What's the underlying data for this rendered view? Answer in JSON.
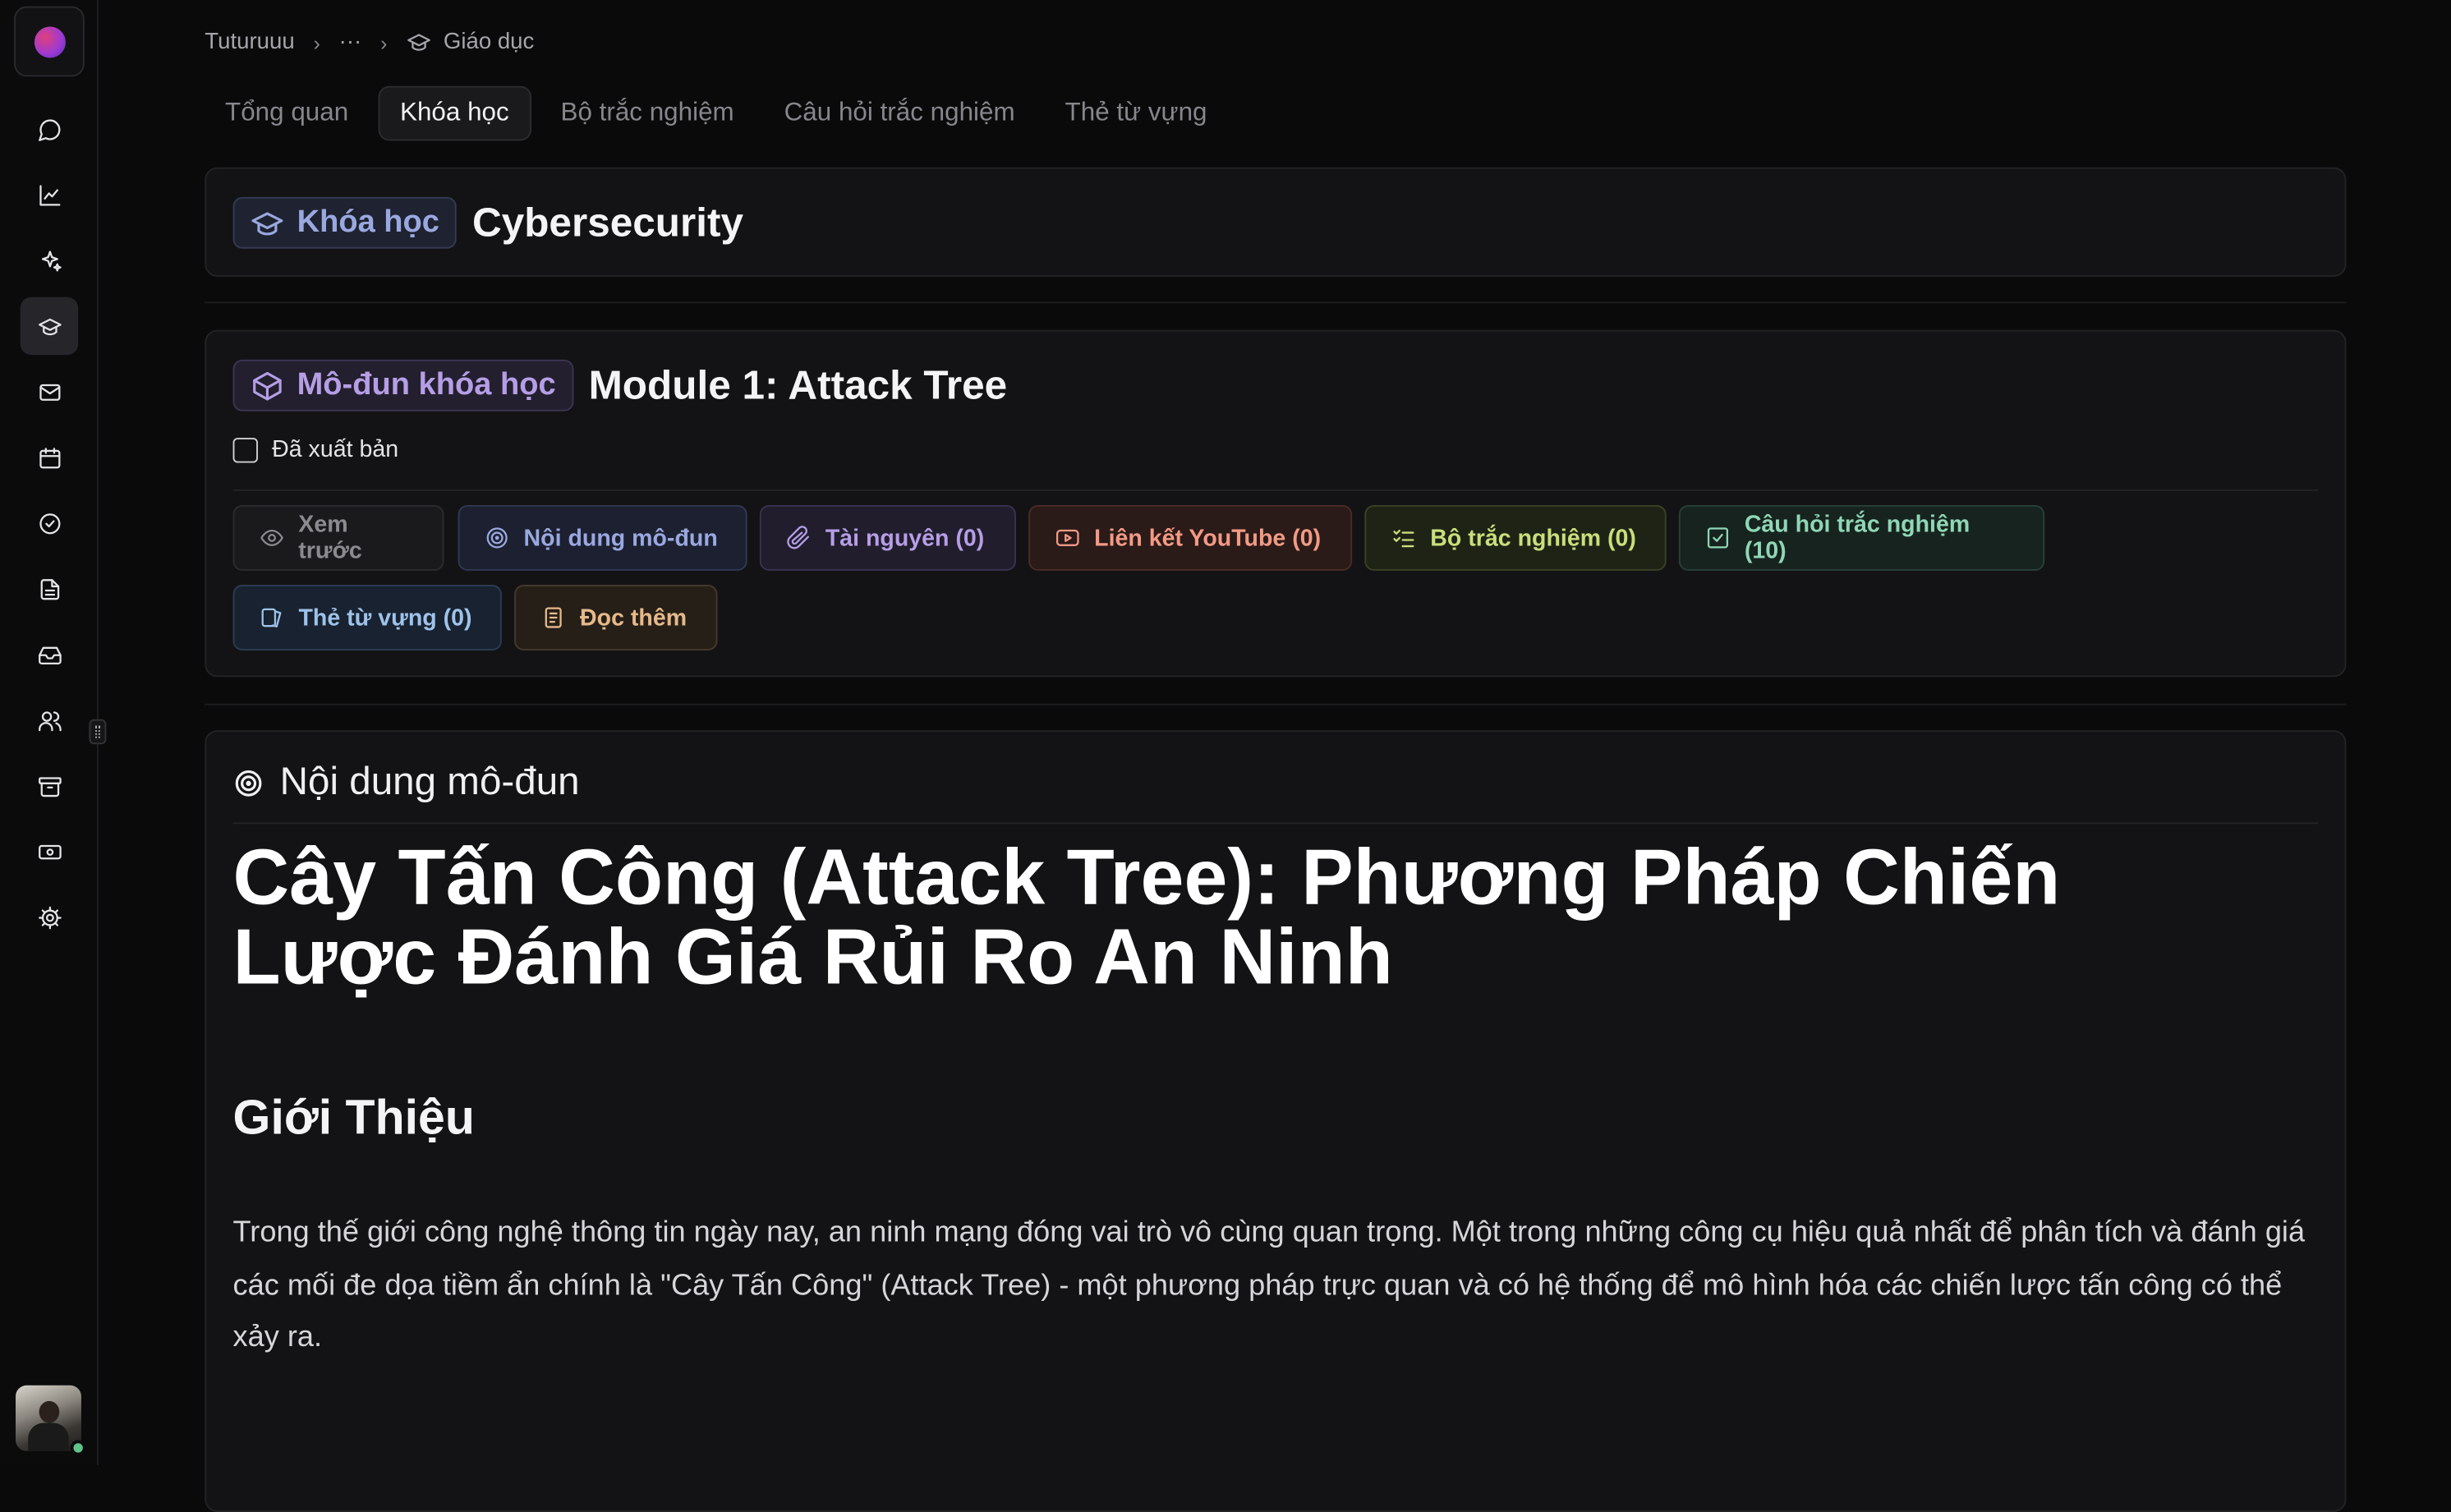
{
  "breadcrumb": {
    "root": "Tuturuuu",
    "ellipsis": "···",
    "current": "Giáo dục"
  },
  "tabs": [
    {
      "label": "Tổng quan",
      "active": false
    },
    {
      "label": "Khóa học",
      "active": true
    },
    {
      "label": "Bộ trắc nghiệm",
      "active": false
    },
    {
      "label": "Câu hỏi trắc nghiệm",
      "active": false
    },
    {
      "label": "Thẻ từ vựng",
      "active": false
    }
  ],
  "sidebar": {
    "items": [
      {
        "icon": "chat-icon"
      },
      {
        "icon": "chart-icon"
      },
      {
        "icon": "sparkles-icon"
      },
      {
        "icon": "graduation-cap-icon",
        "active": true
      },
      {
        "icon": "mail-icon"
      },
      {
        "icon": "calendar-icon"
      },
      {
        "icon": "check-circle-icon"
      },
      {
        "icon": "document-icon"
      },
      {
        "icon": "inbox-icon"
      },
      {
        "icon": "users-icon"
      },
      {
        "icon": "archive-icon"
      },
      {
        "icon": "ticket-icon"
      },
      {
        "icon": "settings-icon"
      }
    ]
  },
  "course": {
    "badge": "Khóa học",
    "title": "Cybersecurity"
  },
  "module": {
    "badge": "Mô-đun khóa học",
    "title": "Module 1: Attack Tree",
    "published_label": "Đã xuất bản",
    "published": false,
    "actions": [
      {
        "label": "Xem trước",
        "icon": "eye-icon",
        "color": "#8a8a90"
      },
      {
        "label": "Nội dung mô-đun",
        "icon": "target-icon",
        "color": "#9aa8e0"
      },
      {
        "label": "Tài nguyên (0)",
        "icon": "paperclip-icon",
        "color": "#b59ee6"
      },
      {
        "label": "Liên kết YouTube (0)",
        "icon": "youtube-icon",
        "color": "#f29a85"
      },
      {
        "label": "Bộ trắc nghiệm (0)",
        "icon": "list-checks-icon",
        "color": "#c9df7a"
      },
      {
        "label": "Câu hỏi trắc nghiệm (10)",
        "icon": "check-square-icon",
        "color": "#8fd7b6"
      },
      {
        "label": "Thẻ từ vựng (0)",
        "icon": "cards-icon",
        "color": "#9ec3ea"
      },
      {
        "label": "Đọc thêm",
        "icon": "book-icon",
        "color": "#e6b98a"
      }
    ]
  },
  "content": {
    "header": "Nội dung mô-đun",
    "heading": "Cây Tấn Công (Attack Tree): Phương Pháp Chiến Lược Đánh Giá Rủi Ro An Ninh",
    "subheading": "Giới Thiệu",
    "paragraph": "Trong thế giới công nghệ thông tin ngày nay, an ninh mạng đóng vai trò vô cùng quan trọng. Một trong những công cụ hiệu quả nhất để phân tích và đánh giá các mối đe dọa tiềm ẩn chính là \"Cây Tấn Công\" (Attack Tree) - một phương pháp trực quan và có hệ thống để mô hình hóa các chiến lược tấn công có thể xảy ra."
  }
}
